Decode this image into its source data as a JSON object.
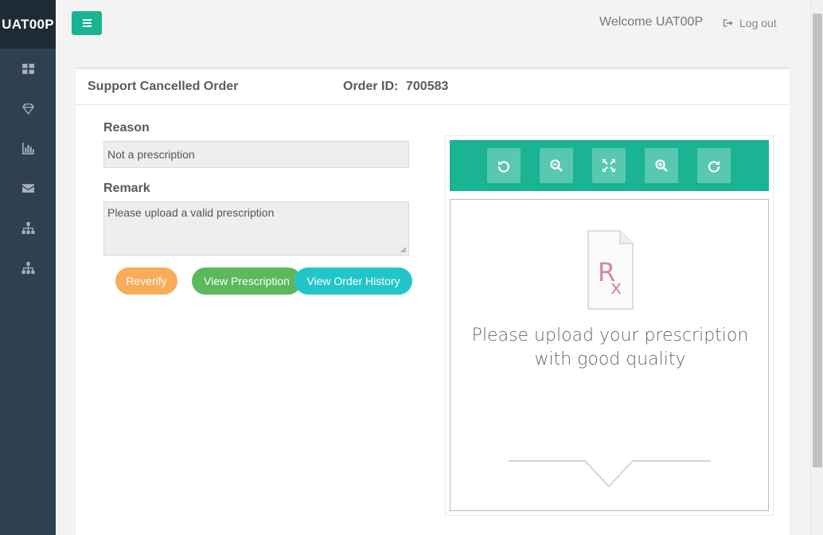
{
  "brand": "UAT00P",
  "header": {
    "welcome": "Welcome UAT00P",
    "logout_label": "Log out"
  },
  "sidebar": {
    "items": [
      {
        "icon": "dashboard-icon"
      },
      {
        "icon": "diamond-icon"
      },
      {
        "icon": "bar-chart-icon"
      },
      {
        "icon": "envelope-icon"
      },
      {
        "icon": "sitemap-icon"
      },
      {
        "icon": "sitemap-icon"
      }
    ]
  },
  "page": {
    "title": "Support Cancelled Order",
    "order_label": "Order ID:",
    "order_id": "700583"
  },
  "form": {
    "reason_label": "Reason",
    "reason_value": "Not a prescription",
    "remark_label": "Remark",
    "remark_value": "Please upload a valid prescription"
  },
  "buttons": {
    "reverify": "Reverify",
    "view_prescription": "View Prescription",
    "view_order_history": "View Order History"
  },
  "viewer": {
    "tools": [
      "rotate-left-icon",
      "zoom-out-icon",
      "fit-screen-icon",
      "zoom-in-icon",
      "rotate-right-icon"
    ],
    "placeholder_line1": "Please upload your prescription",
    "placeholder_line2": "with good quality",
    "rx_symbol_r": "R",
    "rx_symbol_x": "x"
  },
  "colors": {
    "accent": "#1ab394",
    "sidebar": "#2f4050",
    "reverify": "#f8ac59",
    "view_prescription": "#5cb85c",
    "view_order_history": "#23c6c8"
  }
}
